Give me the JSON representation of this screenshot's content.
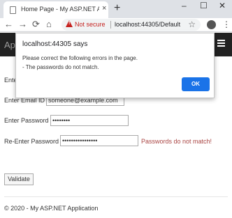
{
  "browser": {
    "tab_title": "Home Page - My ASP.NET Applic",
    "tab_close": "×",
    "new_tab": "+",
    "minimize": "–",
    "maximize": "☐",
    "close": "✕",
    "back": "←",
    "forward": "→",
    "reload": "⟳",
    "home": "⌂",
    "security_label": "Not secure",
    "url": "localhost:44305/Default",
    "star": "☆",
    "menu": "⋮"
  },
  "app": {
    "brand": "Ap"
  },
  "dialog": {
    "title": "localhost:44305 says",
    "line1": "Please correct the following errors in the page.",
    "line2": "- The passwords do not match.",
    "ok_label": "OK"
  },
  "form": {
    "name_label_partial": "Ente",
    "email_label": "Enter Email ID",
    "email_value": "someone@example.com",
    "password_label": "Enter Password",
    "password_value": "••••••••",
    "reenter_label": "Re-Enter Password",
    "reenter_value": "••••••••••••••••",
    "error_text": "Passwords do not match!",
    "validate_label": "Validate"
  },
  "footer": {
    "text": "© 2020 - My ASP.NET Application"
  },
  "colors": {
    "error": "#a94442",
    "ok_button": "#1a73e8",
    "navbar": "#222222"
  }
}
